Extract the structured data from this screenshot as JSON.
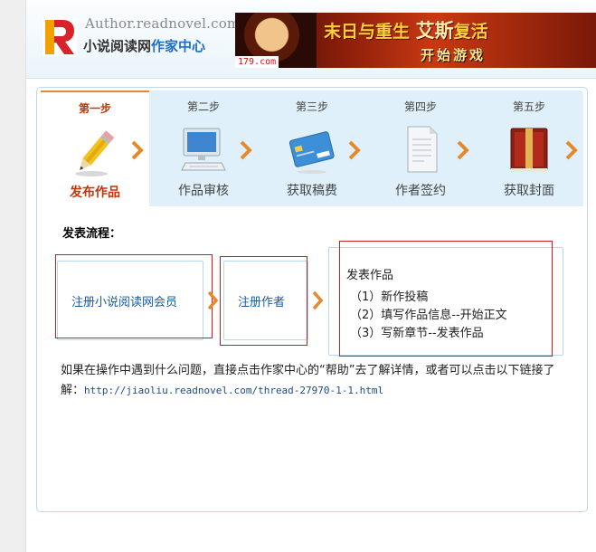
{
  "header": {
    "logo_letter": "R",
    "logo_en": "Author.readnovel.com",
    "logo_cn_main": "小说阅读网",
    "logo_cn_accent": "作家中心",
    "banner": {
      "site": "179.com",
      "title_a": "末日与重生",
      "title_b": "艾斯",
      "title_c": "复活",
      "subtitle": "开始游戏"
    }
  },
  "steps": [
    {
      "label": "第一步",
      "name": "发布作品",
      "icon": "pencil-icon",
      "active": true
    },
    {
      "label": "第二步",
      "name": "作品审核",
      "icon": "computer-icon",
      "active": false
    },
    {
      "label": "第三步",
      "name": "获取稿费",
      "icon": "credit-card-icon",
      "active": false
    },
    {
      "label": "第四步",
      "name": "作者签约",
      "icon": "document-icon",
      "active": false
    },
    {
      "label": "第五步",
      "name": "获取封面",
      "icon": "book-icon",
      "active": false
    }
  ],
  "flow": {
    "title": "发表流程：",
    "box1": "注册小说阅读网会员",
    "box2": "注册作者",
    "box3_title": "发表作品",
    "box3_items": [
      "（1）新作投稿",
      "（2）填写作品信息--开始正文",
      "（3）写新章节--发表作品"
    ]
  },
  "help": {
    "text": "如果在操作中遇到什么问题，直接点击作家中心的“帮助”去了解详情，或者可以点击以下链接了解：",
    "link": "http://jiaoliu.readnovel.com/thread-27970-1-1.html"
  },
  "colors": {
    "accent_orange": "#e5892a",
    "active_red": "#c0360c",
    "tab_bg": "#dff0fa",
    "link_blue": "#1a4b8c",
    "annotation_red": "#c81e1e"
  }
}
